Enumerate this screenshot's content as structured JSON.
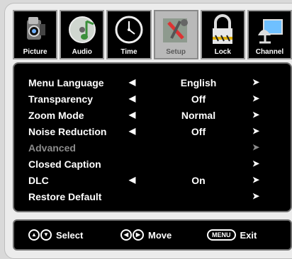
{
  "tabs": [
    {
      "label": "Picture",
      "icon": "camera-icon"
    },
    {
      "label": "Audio",
      "icon": "music-note-icon"
    },
    {
      "label": "Time",
      "icon": "clock-icon"
    },
    {
      "label": "Setup",
      "icon": "tools-icon",
      "active": true
    },
    {
      "label": "Lock",
      "icon": "padlock-icon"
    },
    {
      "label": "Channel",
      "icon": "satellite-dish-icon"
    }
  ],
  "menu": {
    "rows": [
      {
        "label": "Menu Language",
        "value": "English",
        "left_arrow": "◀",
        "right_arrow": "➤"
      },
      {
        "label": "Transparency",
        "value": "Off",
        "left_arrow": "◀",
        "right_arrow": "➤"
      },
      {
        "label": "Zoom Mode",
        "value": "Normal",
        "left_arrow": "◀",
        "right_arrow": "➤"
      },
      {
        "label": "Noise Reduction",
        "value": "Off",
        "left_arrow": "◀",
        "right_arrow": "➤"
      },
      {
        "label": "Advanced",
        "value": "",
        "left_arrow": "",
        "right_arrow": "➤",
        "disabled": true
      },
      {
        "label": "Closed Caption",
        "value": "",
        "left_arrow": "",
        "right_arrow": "➤"
      },
      {
        "label": "DLC",
        "value": "On",
        "left_arrow": "◀",
        "right_arrow": "➤"
      },
      {
        "label": "Restore Default",
        "value": "",
        "left_arrow": "",
        "right_arrow": "➤"
      }
    ]
  },
  "footer": {
    "select_label": "Select",
    "move_label": "Move",
    "menu_key": "MENU",
    "exit_label": "Exit"
  },
  "colors": {
    "background": "#000000",
    "text": "#ffffff",
    "disabled_text": "#8b8b8b",
    "active_tab": "#b9b9b9"
  }
}
